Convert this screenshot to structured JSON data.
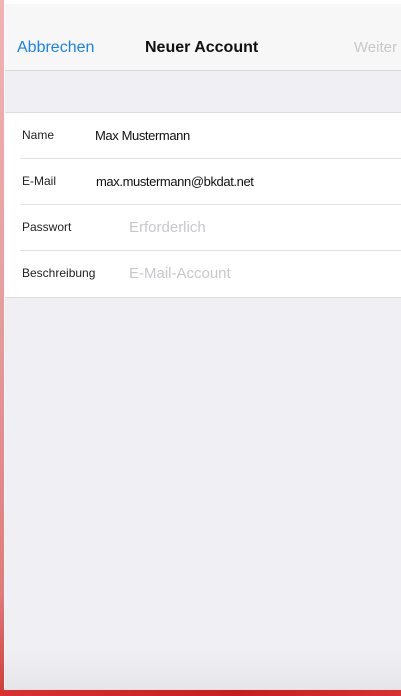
{
  "navbar": {
    "cancel_label": "Abbrechen",
    "title": "Neuer Account",
    "next_label": "Weiter"
  },
  "form": {
    "rows": [
      {
        "label": "Name",
        "value": "Max Mustermann",
        "placeholder": ""
      },
      {
        "label": "E-Mail",
        "value": "max.mustermann@bkdat.net",
        "placeholder": ""
      },
      {
        "label": "Passwort",
        "value": "",
        "placeholder": "Erforderlich"
      },
      {
        "label": "Beschreibung",
        "value": "",
        "placeholder": "E-Mail-Account"
      }
    ]
  },
  "colors": {
    "accent": "#1a82f0",
    "disabled": "#c8c8cc",
    "frame_edge": "#d53a3a"
  }
}
